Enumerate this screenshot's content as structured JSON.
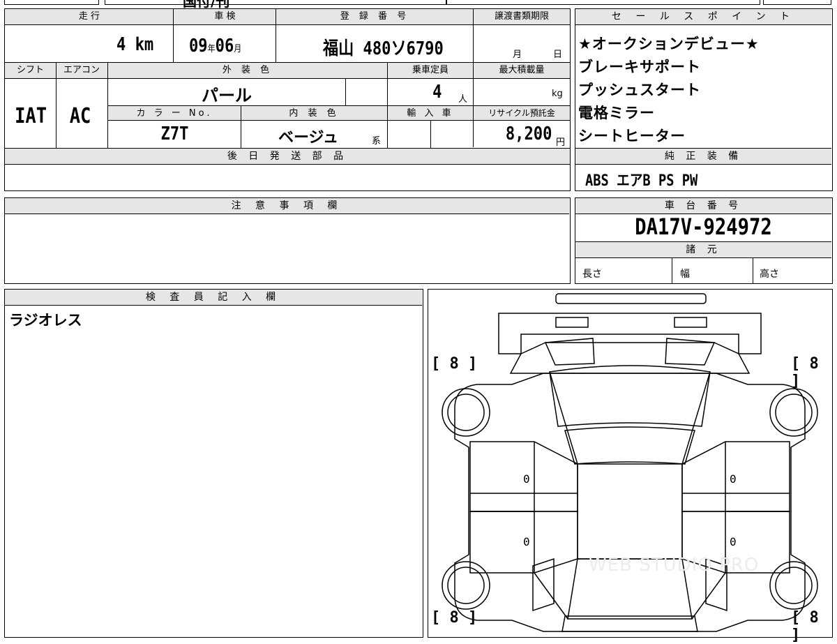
{
  "top_row": {
    "partial_text": "国付/刊"
  },
  "basic": {
    "mileage_label": "走 行",
    "mileage_value": "4",
    "mileage_unit": "km",
    "shaken_label": "車 検",
    "shaken_year": "09",
    "shaken_year_unit": "年",
    "shaken_month": "06",
    "shaken_month_unit": "月",
    "reg_label": "登 録 番 号",
    "reg_region": "福山",
    "reg_class": "480",
    "reg_kana": "ソ",
    "reg_number": "6790",
    "transfer_label": "譲渡書類期限",
    "transfer_month_unit": "月",
    "transfer_day_unit": "日"
  },
  "specs": {
    "shift_label": "シフト",
    "shift_value": "IAT",
    "ac_label": "エアコン",
    "ac_value": "AC",
    "exterior_label": "外 装 色",
    "exterior_value": "パール",
    "capacity_label": "乗車定員",
    "capacity_value": "4",
    "capacity_unit": "人",
    "load_label": "最大積載量",
    "load_unit": "kg",
    "color_no_label": "カ ラ ー No.",
    "color_no_value": "Z7T",
    "interior_label": "内 装 色",
    "interior_value": "ベージュ",
    "interior_suffix": "系",
    "import_label": "輸 入 車",
    "recycle_label": "リサイクル預託金",
    "recycle_value": "8,200",
    "recycle_unit": "円"
  },
  "later_parts": {
    "label": "後 日 発 送 部 品"
  },
  "sales_points": {
    "label": "セ ー ル ス ポ イ ン ト",
    "items": [
      "★オークションデビュー★",
      "ブレーキサポート",
      "プッシュスタート",
      "電格ミラー",
      "シートヒーター"
    ]
  },
  "standard_equipment": {
    "label": "純 正 装 備",
    "value": "ABS エアB PS PW"
  },
  "notes": {
    "label": "注 意 事 項 欄"
  },
  "chassis": {
    "label": "車 台 番 号",
    "value": "DA17V-924972"
  },
  "dimensions": {
    "label": "諸 元",
    "length": "長さ",
    "width": "幅",
    "height": "高さ"
  },
  "inspector": {
    "label": "検 査 員 記 入 欄",
    "text": "ラジオレス"
  },
  "diagram": {
    "tire_fl": "[ 8 ]",
    "tire_fr": "[ 8 ]",
    "tire_rl": "[ 8 ]",
    "tire_rr": "[ 8 ]",
    "zero_1": "0",
    "zero_2": "0",
    "zero_3": "0",
    "zero_4": "0",
    "watermark": "WEB STUDIO PRO"
  }
}
